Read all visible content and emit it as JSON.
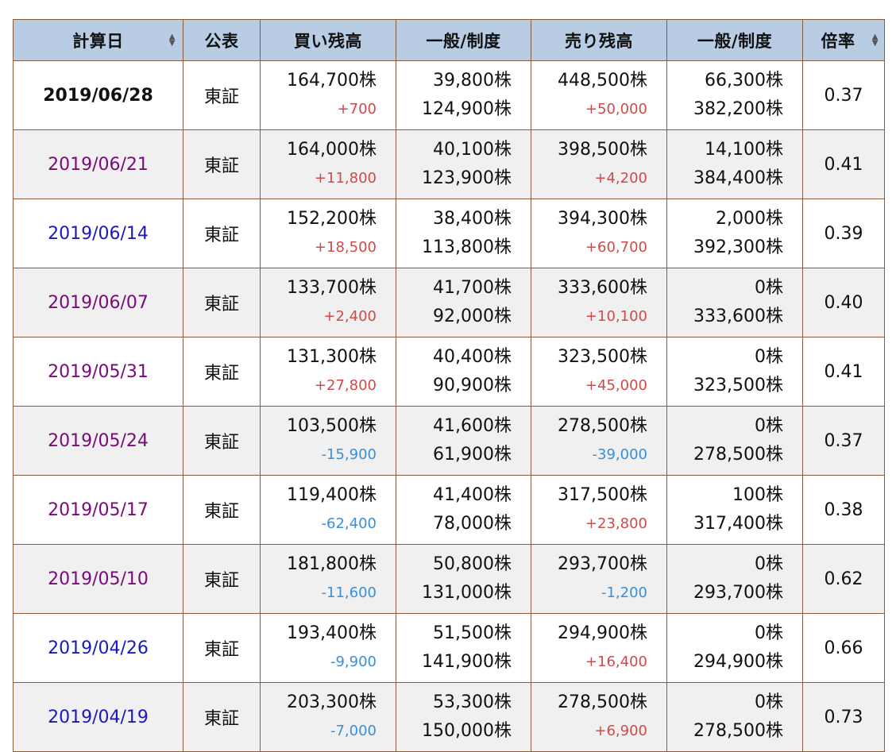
{
  "header": {
    "date": "計算日",
    "pub": "公表",
    "buy": "買い残高",
    "buy_type": "一般/制度",
    "sell": "売り残高",
    "sell_type": "一般/制度",
    "ratio": "倍率"
  },
  "colors": {
    "header_bg": "#b8cce4",
    "border": "#8b5a3c",
    "increase": "#d04a4a",
    "decrease": "#3a8fd8",
    "visited_link": "#7a0a7a",
    "link": "#1a1ab8"
  },
  "rows": [
    {
      "date": "2019/06/28",
      "pub": "東証",
      "buy": "164,700株",
      "buy_chg": "+700",
      "buy_gen": "39,800株",
      "buy_sys": "124,900株",
      "sell": "448,500株",
      "sell_chg": "+50,000",
      "sell_gen": "66,300株",
      "sell_sys": "382,200株",
      "ratio": "0.37"
    },
    {
      "date": "2019/06/21",
      "pub": "東証",
      "buy": "164,000株",
      "buy_chg": "+11,800",
      "buy_gen": "40,100株",
      "buy_sys": "123,900株",
      "sell": "398,500株",
      "sell_chg": "+4,200",
      "sell_gen": "14,100株",
      "sell_sys": "384,400株",
      "ratio": "0.41"
    },
    {
      "date": "2019/06/14",
      "pub": "東証",
      "buy": "152,200株",
      "buy_chg": "+18,500",
      "buy_gen": "38,400株",
      "buy_sys": "113,800株",
      "sell": "394,300株",
      "sell_chg": "+60,700",
      "sell_gen": "2,000株",
      "sell_sys": "392,300株",
      "ratio": "0.39"
    },
    {
      "date": "2019/06/07",
      "pub": "東証",
      "buy": "133,700株",
      "buy_chg": "+2,400",
      "buy_gen": "41,700株",
      "buy_sys": "92,000株",
      "sell": "333,600株",
      "sell_chg": "+10,100",
      "sell_gen": "0株",
      "sell_sys": "333,600株",
      "ratio": "0.40"
    },
    {
      "date": "2019/05/31",
      "pub": "東証",
      "buy": "131,300株",
      "buy_chg": "+27,800",
      "buy_gen": "40,400株",
      "buy_sys": "90,900株",
      "sell": "323,500株",
      "sell_chg": "+45,000",
      "sell_gen": "0株",
      "sell_sys": "323,500株",
      "ratio": "0.41"
    },
    {
      "date": "2019/05/24",
      "pub": "東証",
      "buy": "103,500株",
      "buy_chg": "-15,900",
      "buy_gen": "41,600株",
      "buy_sys": "61,900株",
      "sell": "278,500株",
      "sell_chg": "-39,000",
      "sell_gen": "0株",
      "sell_sys": "278,500株",
      "ratio": "0.37"
    },
    {
      "date": "2019/05/17",
      "pub": "東証",
      "buy": "119,400株",
      "buy_chg": "-62,400",
      "buy_gen": "41,400株",
      "buy_sys": "78,000株",
      "sell": "317,500株",
      "sell_chg": "+23,800",
      "sell_gen": "100株",
      "sell_sys": "317,400株",
      "ratio": "0.38"
    },
    {
      "date": "2019/05/10",
      "pub": "東証",
      "buy": "181,800株",
      "buy_chg": "-11,600",
      "buy_gen": "50,800株",
      "buy_sys": "131,000株",
      "sell": "293,700株",
      "sell_chg": "-1,200",
      "sell_gen": "0株",
      "sell_sys": "293,700株",
      "ratio": "0.62"
    },
    {
      "date": "2019/04/26",
      "pub": "東証",
      "buy": "193,400株",
      "buy_chg": "-9,900",
      "buy_gen": "51,500株",
      "buy_sys": "141,900株",
      "sell": "294,900株",
      "sell_chg": "+16,400",
      "sell_gen": "0株",
      "sell_sys": "294,900株",
      "ratio": "0.66"
    },
    {
      "date": "2019/04/19",
      "pub": "東証",
      "buy": "203,300株",
      "buy_chg": "-7,000",
      "buy_gen": "53,300株",
      "buy_sys": "150,000株",
      "sell": "278,500株",
      "sell_chg": "+6,900",
      "sell_gen": "0株",
      "sell_sys": "278,500株",
      "ratio": "0.73"
    }
  ]
}
